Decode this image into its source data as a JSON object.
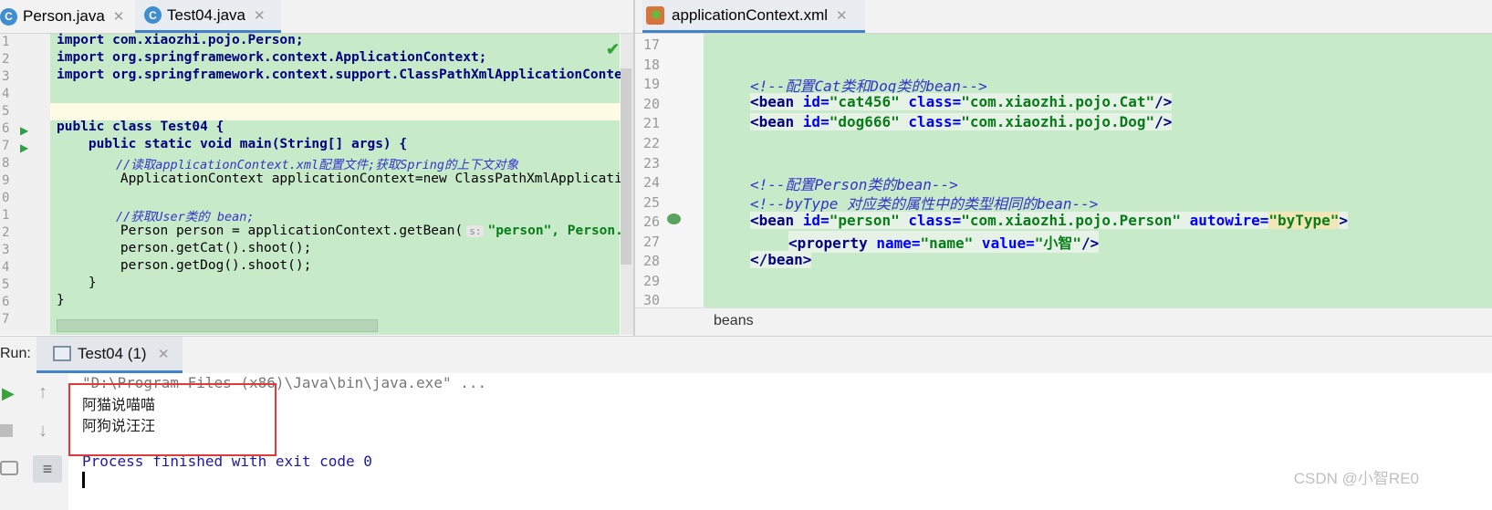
{
  "left_tabs": [
    {
      "icon": "C",
      "label": "Person.java",
      "active": false
    },
    {
      "icon": "C",
      "label": "Test04.java",
      "active": true
    }
  ],
  "right_tabs": [
    {
      "label": "applicationContext.xml",
      "active": true
    }
  ],
  "java_editor": {
    "line_numbers": [
      "1",
      "2",
      "3",
      "4",
      "5",
      "6",
      "7",
      "8",
      "9",
      "0",
      "1",
      "2",
      "3",
      "4",
      "5",
      "6",
      "7"
    ],
    "lines": [
      "import com.xiaozhi.pojo.Person;",
      "import org.springframework.context.ApplicationContext;",
      "import org.springframework.context.support.ClassPathXmlApplicationContext",
      "",
      "",
      "public class Test04 {",
      "    public static void main(String[] args) {",
      "        //读取applicationContext.xml配置文件;获取Spring的上下文对象",
      "        ApplicationContext applicationContext=new ClassPathXmlApplication",
      "",
      "        //获取User类的 bean;",
      "        Person person = applicationContext.getBean(",
      "        person.getCat().shoot();",
      "        person.getDog().shoot();",
      "    }",
      "}",
      ""
    ],
    "param_hint": "s:",
    "line12_tail": "\"person\", Person.cl"
  },
  "xml_editor": {
    "line_numbers": [
      "17",
      "18",
      "19",
      "20",
      "21",
      "22",
      "23",
      "24",
      "25",
      "26",
      "27",
      "28",
      "29",
      "30"
    ],
    "comment_cat_dog": "<!--配置Cat类和Dog类的bean-->",
    "comment_person": "<!--配置Person类的bean-->",
    "comment_bytype": "<!--byType 对应类的属性中的类型相同的bean-->",
    "bean1": {
      "id": "\"cat456\"",
      "class": "\"com.xiaozhi.pojo.Cat\""
    },
    "bean2": {
      "id": "\"dog666\"",
      "class": "\"com.xiaozhi.pojo.Dog\""
    },
    "bean3": {
      "id": "\"person\"",
      "class": "\"com.xiaozhi.pojo.Person\"",
      "autowire": "\"byType\""
    },
    "property": {
      "name": "\"name\"",
      "value": "\"小智\""
    },
    "breadcrumb": "beans"
  },
  "run_panel": {
    "label": "Run:",
    "tab_label": "Test04 (1)",
    "console_lines": [
      "\"D:\\Program Files (x86)\\Java\\bin\\java.exe\" ...",
      "阿猫说喵喵",
      "阿狗说汪汪",
      "",
      "Process finished with exit code 0"
    ]
  },
  "watermark": "CSDN @小智RE0",
  "colors": {
    "code_bg": "#c7ebc9",
    "keyword": "#000080",
    "string": "#067d17",
    "comment": "#3333cc",
    "highlight_box": "#e03a3a"
  }
}
